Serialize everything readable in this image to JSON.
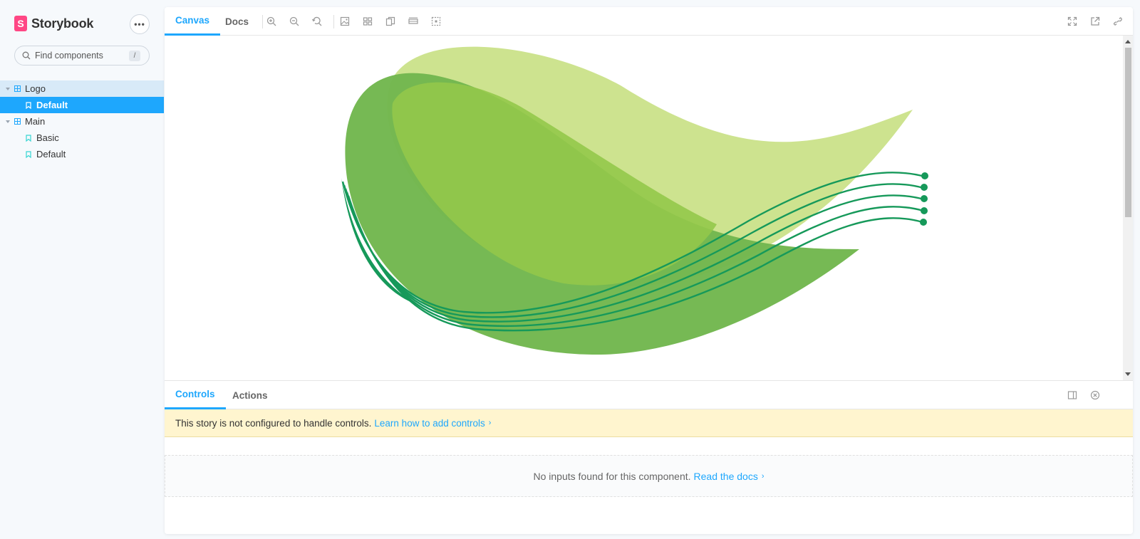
{
  "sidebar": {
    "brand": "Storybook",
    "brand_mark": "S",
    "menu_label": "•••",
    "search": {
      "placeholder": "Find components",
      "shortcut": "/"
    },
    "tree": [
      {
        "label": "Logo",
        "type": "component"
      },
      {
        "label": "Default",
        "type": "story",
        "selected": true
      },
      {
        "label": "Main",
        "type": "component"
      },
      {
        "label": "Basic",
        "type": "story"
      },
      {
        "label": "Default",
        "type": "story"
      }
    ]
  },
  "toolbar": {
    "tabs": [
      {
        "label": "Canvas",
        "active": true
      },
      {
        "label": "Docs"
      }
    ],
    "tools": [
      "zoom-in-icon",
      "zoom-out-icon",
      "zoom-reset-icon",
      "background-icon",
      "grid-icon",
      "viewport-icon",
      "measure-icon",
      "outline-icon"
    ],
    "right_tools": [
      "fullscreen-icon",
      "open-new-tab-icon",
      "copy-link-icon"
    ]
  },
  "addons": {
    "tabs": [
      {
        "label": "Controls",
        "active": true
      },
      {
        "label": "Actions"
      }
    ],
    "notice_text": "This story is not configured to handle controls.",
    "notice_link": "Learn how to add controls",
    "empty_text": "No inputs found for this component.",
    "empty_link": "Read the docs",
    "chevron": "›"
  },
  "colors": {
    "accent": "#1ea7fd",
    "brand": "#ff4785",
    "leaf_light": "#cde38f",
    "leaf_mid": "#72b74e",
    "leaf_overlap": "#94c84a",
    "lines": "#16995a"
  }
}
